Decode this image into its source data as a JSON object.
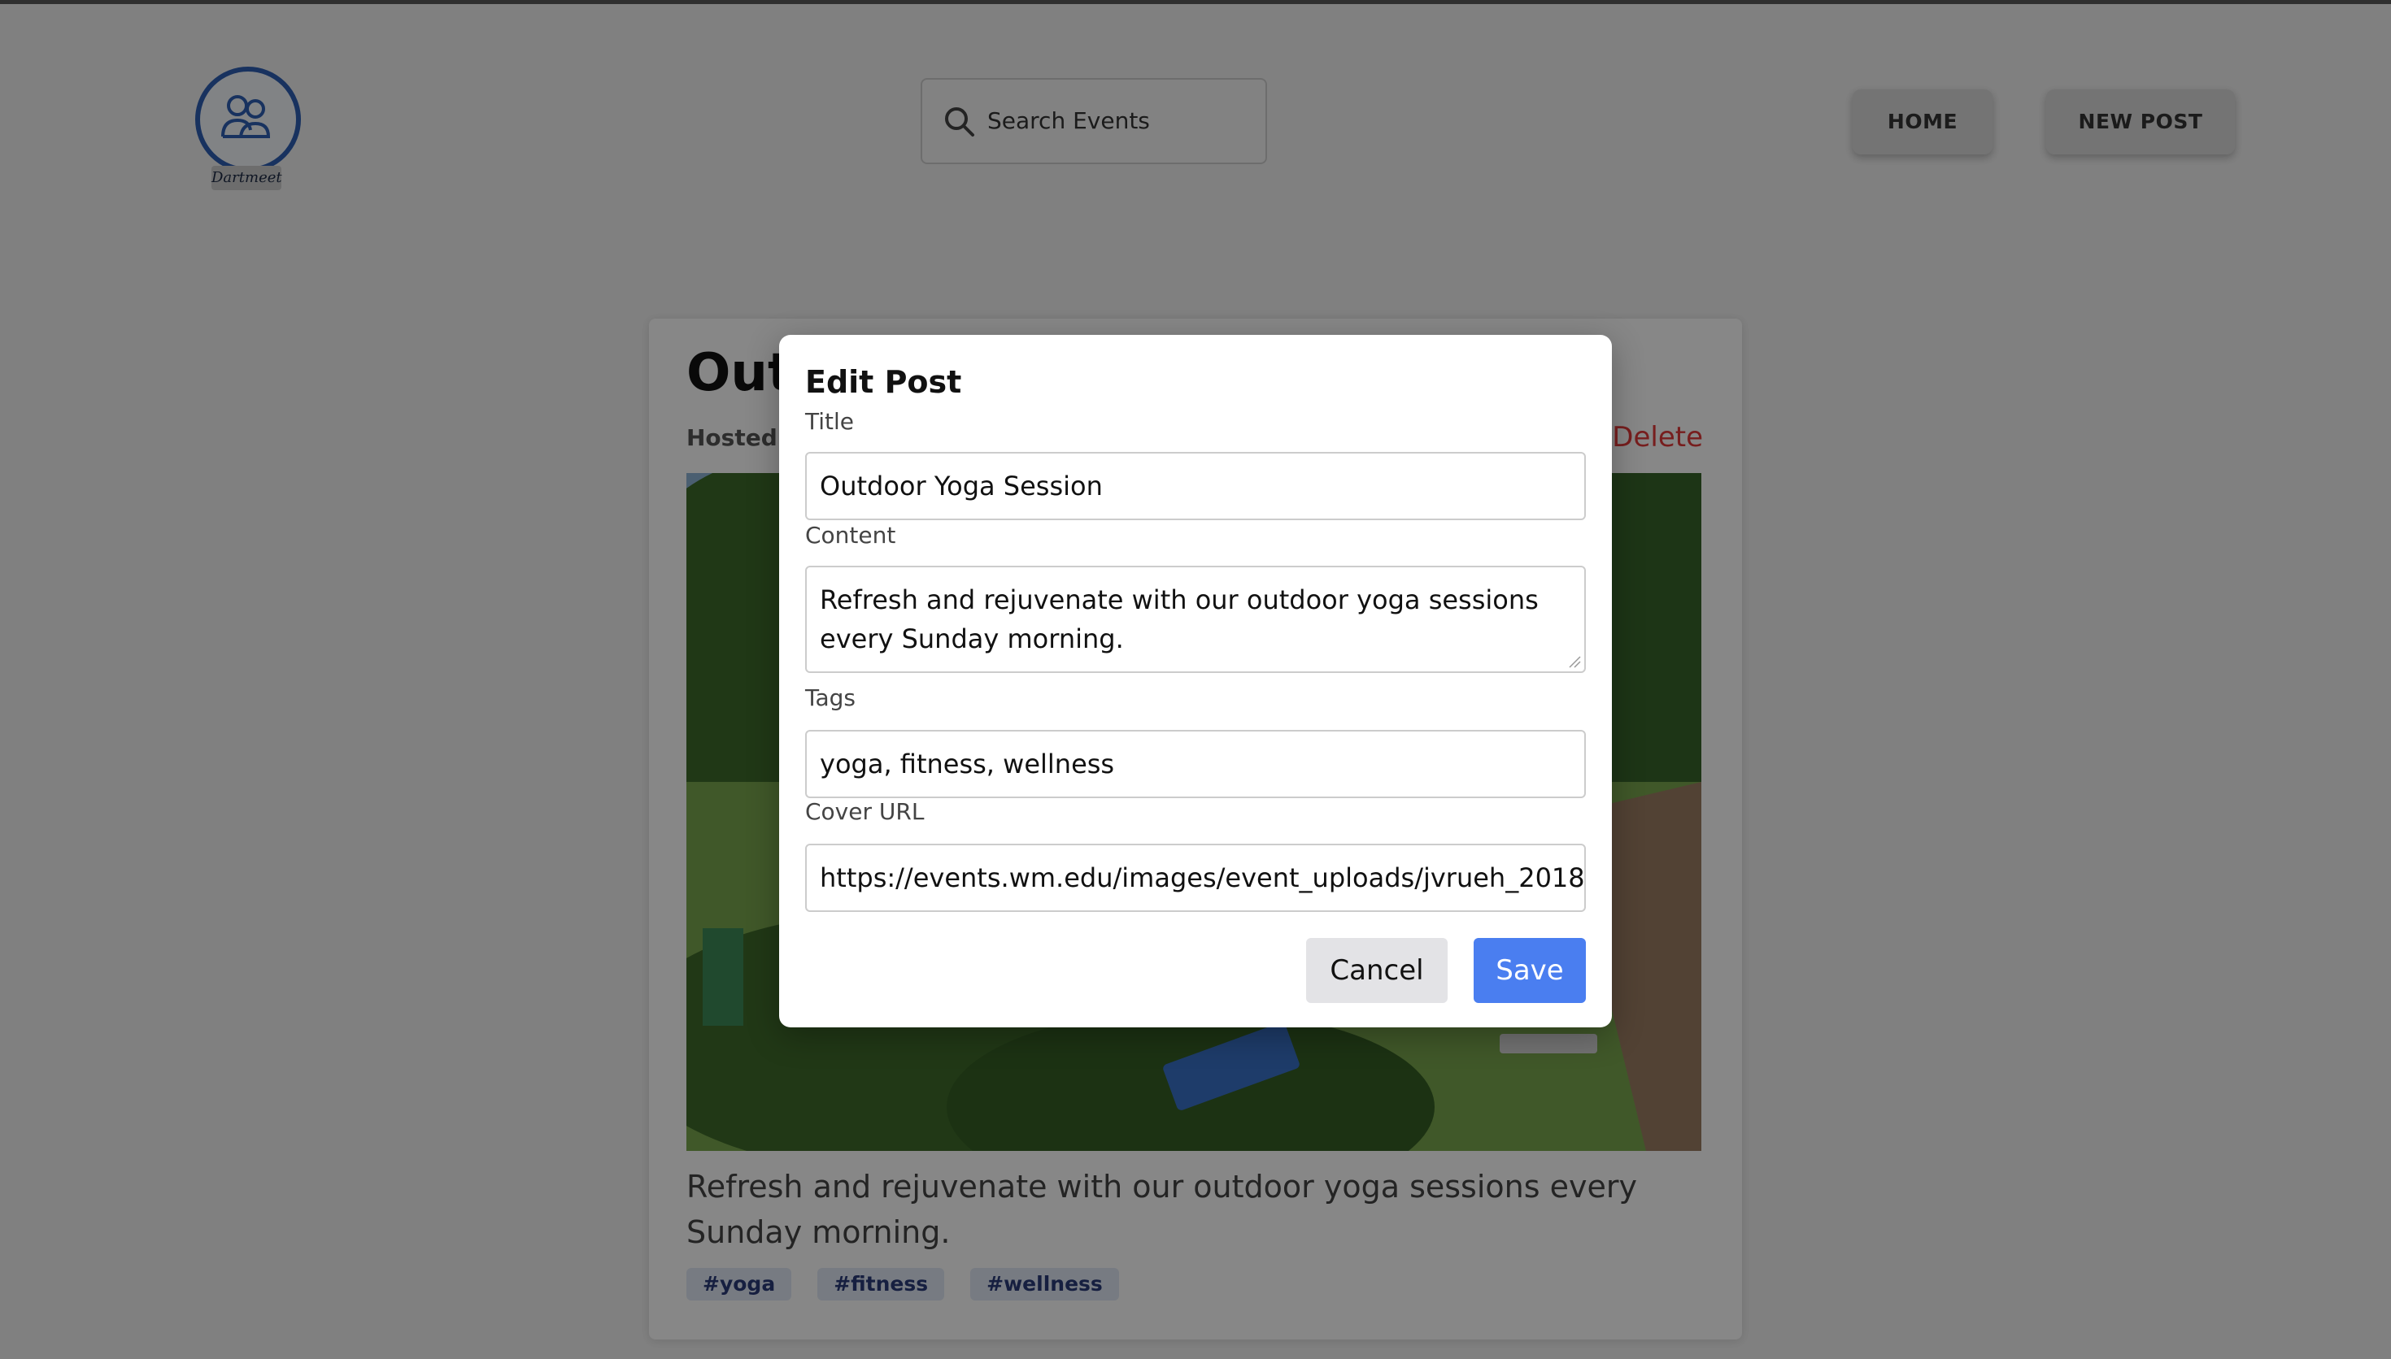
{
  "header": {
    "logo_text": "Dartmeet",
    "search": {
      "placeholder": "Search Events"
    },
    "nav": {
      "home_label": "HOME",
      "new_post_label": "NEW POST"
    }
  },
  "post": {
    "title": "Outdoor Yoga Session",
    "title_visible": "Out",
    "hosted_label": "Hosted",
    "delete_label": "Delete",
    "content": "Refresh and rejuvenate with our outdoor yoga sessions every Sunday morning.",
    "tags": [
      "#yoga",
      "#fitness",
      "#wellness"
    ]
  },
  "modal": {
    "title": "Edit Post",
    "fields": {
      "title_label": "Title",
      "title_value": "Outdoor Yoga Session",
      "content_label": "Content",
      "content_value": "Refresh and rejuvenate with our outdoor yoga sessions every Sunday morning.",
      "tags_label": "Tags",
      "tags_value": "yoga, fitness, wellness",
      "cover_label": "Cover URL",
      "cover_value": "https://events.wm.edu/images/event_uploads/jvrueh_2018"
    },
    "cancel_label": "Cancel",
    "save_label": "Save"
  },
  "colors": {
    "accent": "#4a7ef0",
    "delete": "#e03a3a",
    "tag_bg": "#e1e8f6",
    "logo": "#2f5fb3"
  }
}
